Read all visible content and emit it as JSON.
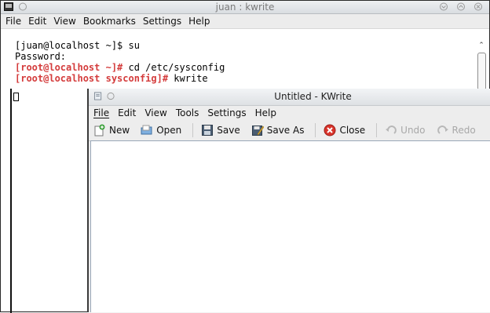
{
  "terminal": {
    "title": "juan : kwrite",
    "menu": [
      "File",
      "Edit",
      "View",
      "Bookmarks",
      "Settings",
      "Help"
    ],
    "lines": [
      {
        "prompt": "[juan@localhost ~]$",
        "cmd": " su",
        "red": false
      },
      {
        "prompt": "Password:",
        "cmd": "",
        "red": false
      },
      {
        "prompt": "[root@localhost ~]#",
        "cmd": " cd /etc/sysconfig",
        "red": true
      },
      {
        "prompt": "[root@localhost sysconfig]#",
        "cmd": " kwrite",
        "red": true
      }
    ]
  },
  "kwrite": {
    "title": "Untitled - KWrite",
    "menu": [
      "File",
      "Edit",
      "View",
      "Tools",
      "Settings",
      "Help"
    ],
    "toolbar": {
      "new": "New",
      "open": "Open",
      "save": "Save",
      "save_as": "Save As",
      "close": "Close",
      "undo": "Undo",
      "redo": "Redo"
    }
  }
}
